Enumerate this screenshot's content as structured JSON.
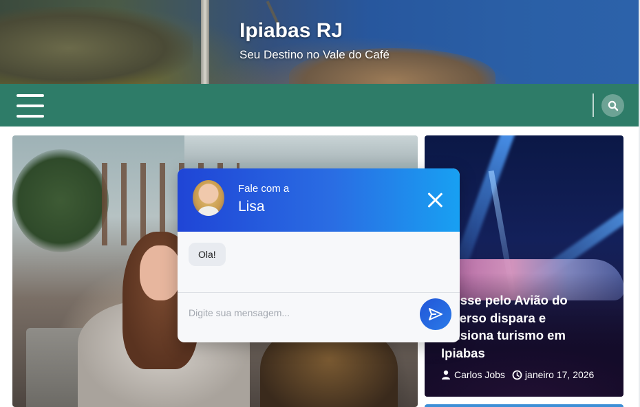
{
  "site": {
    "title": "Ipiabas RJ",
    "tagline": "Seu Destino no Vale do Café"
  },
  "nav": {
    "menu_icon": "hamburger-menu-icon",
    "search_icon": "search-icon"
  },
  "side_article": {
    "title": "Interesse pelo Avião do Metaverso dispara e impulsiona turismo em Ipiabas",
    "visible_title_lines": [
      "eresse pelo Avião do",
      "taverso dispara e",
      "pulsiona turismo em",
      "Ipiabas"
    ],
    "author": "Carlos Jobs",
    "date": "janeiro 17, 2026",
    "author_icon": "user-icon",
    "date_icon": "clock-icon"
  },
  "chat": {
    "subtitle": "Fale com a",
    "name": "Lisa",
    "message": "Ola!",
    "input_placeholder": "Digite sua mensagem...",
    "close_icon": "close-icon",
    "send_icon": "send-icon"
  },
  "colors": {
    "navbar": "#2e7c68",
    "chat_header_start": "#1f45d6",
    "chat_header_end": "#18a0f2",
    "send_button": "#2256d8"
  }
}
